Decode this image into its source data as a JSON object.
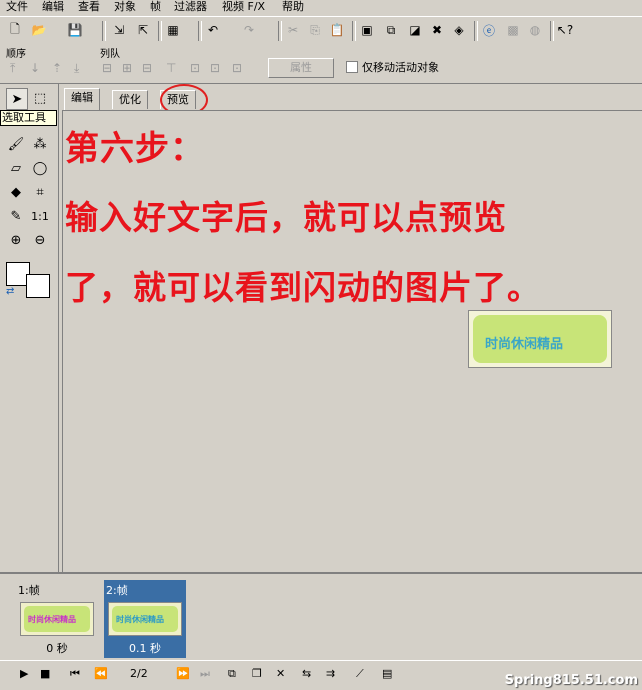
{
  "menu": [
    "文件",
    "编辑",
    "查看",
    "对象",
    "帧",
    "过滤器",
    "视频 F/X",
    "帮助"
  ],
  "toolbar2": {
    "order_label": "顺序",
    "align_label": "列队",
    "properties_button": "属性",
    "move_active_only": "仅移动活动对象"
  },
  "tooltip": "选取工具",
  "tabs": [
    "编辑",
    "优化",
    "预览"
  ],
  "instructions": {
    "line1": "第六步：",
    "line2": "输入好文字后，就可以点预览",
    "line3": "了，就可以看到闪动的图片了。"
  },
  "preview_text": "时尚休闲精品",
  "frames": [
    {
      "title": "1:帧",
      "time": "0 秒",
      "thumb_text": "时尚休闲精品",
      "selected": false
    },
    {
      "title": "2:帧",
      "time": "0.1 秒",
      "thumb_text": "时尚休闲精品",
      "selected": true
    }
  ],
  "frame_counter": "2/2",
  "watermark": "Spring815.51.com",
  "colors": {
    "accent": "#e8141c",
    "selection": "#3a6ea5"
  }
}
